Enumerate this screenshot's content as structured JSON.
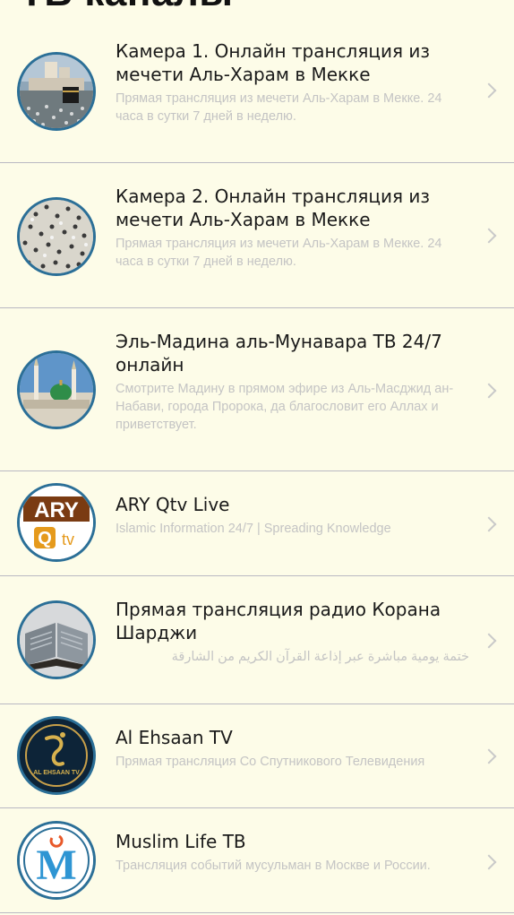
{
  "header": {
    "title": "ТВ каналы"
  },
  "channels": [
    {
      "title": "Камера 1. Онлайн трансляция из мечети Аль-Харам в Мекке",
      "subtitle": "Прямая трансляция из мечети Аль-Харам в Мекке. 24 часа в сутки 7 дней в неделю.",
      "icon": "kaaba-thumbnail-icon"
    },
    {
      "title": "Камера 2. Онлайн трансляция из мечети Аль-Харам в Мекке",
      "subtitle": "Прямая трансляция из мечети Аль-Харам в Мекке. 24 часа в сутки 7 дней в неделю.",
      "icon": "crowd-thumbnail-icon"
    },
    {
      "title": "Эль-Мадина аль-Мунавара ТВ 24/7 онлайн",
      "subtitle": "Смотрите Мадину в прямом эфире из Аль-Масджид ан-Набави, города Пророка, да благословит его Аллах и приветствует.",
      "icon": "medina-mosque-thumbnail-icon"
    },
    {
      "title": "ARY Qtv Live",
      "subtitle": "Islamic Information 24/7 | Spreading Knowledge",
      "icon": "ary-qtv-logo-icon",
      "logo_text_top": "ARY",
      "logo_text_bottom": "tv"
    },
    {
      "title": "Прямая трансляция радио Корана Шарджи",
      "subtitle": "ختمة يومية مباشرة عبر إذاعة القرآن الكريم من الشارقة",
      "icon": "quran-book-thumbnail-icon"
    },
    {
      "title": "Al Ehsaan TV",
      "subtitle": "Прямая трансляция Со Спутникового Телевидения",
      "icon": "al-ehsaan-logo-icon",
      "logo_text": "AL EHSAAN TV"
    },
    {
      "title": "Muslim Life ТВ",
      "subtitle": "Трансляция событий мусульман в Москве и России.",
      "icon": "muslim-life-logo-icon",
      "logo_letter": "M"
    }
  ],
  "colors": {
    "background": "#fdfce8",
    "divider": "#b9b8c2",
    "avatar_ring": "#2b6f97",
    "subtitle": "#c4c4c4"
  }
}
